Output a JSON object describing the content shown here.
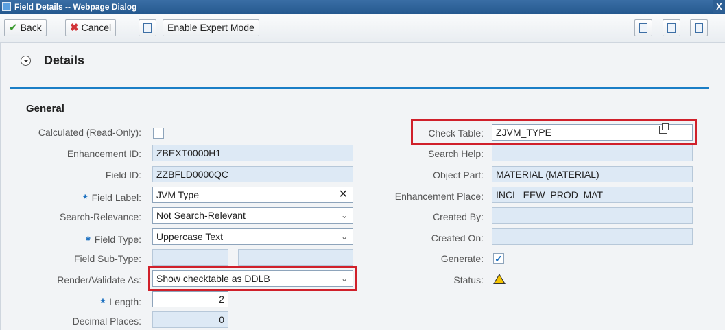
{
  "window": {
    "title": "Field Details -- Webpage Dialog",
    "close_glyph": "X"
  },
  "toolbar": {
    "back_label": "Back",
    "cancel_label": "Cancel",
    "expert_mode_label": "Enable Expert Mode",
    "right_icons": [
      "personalize-icon",
      "list-icon",
      "user-settings-icon"
    ]
  },
  "section": {
    "title": "Details",
    "group_title": "General"
  },
  "left_fields": {
    "calculated": {
      "label": "Calculated (Read-Only):",
      "checked": false
    },
    "enhancement_id": {
      "label": "Enhancement ID:",
      "value": "ZBEXT0000H1"
    },
    "field_id": {
      "label": "Field ID:",
      "value": "ZZBFLD0000QC"
    },
    "field_label": {
      "label": "Field Label:",
      "value": "JVM Type",
      "required": true
    },
    "search_relevance": {
      "label": "Search-Relevance:",
      "value": "Not Search-Relevant"
    },
    "field_type": {
      "label": "Field Type:",
      "value": "Uppercase Text",
      "required": true
    },
    "field_sub_type": {
      "label": "Field Sub-Type:",
      "value": ""
    },
    "render_validate": {
      "label": "Render/Validate As:",
      "value": "Show checktable as DDLB"
    },
    "length": {
      "label": "Length:",
      "value": "2",
      "required": true
    },
    "decimal_places": {
      "label": "Decimal Places:",
      "value": "0"
    }
  },
  "right_fields": {
    "check_table": {
      "label": "Check Table:",
      "value": "ZJVM_TYPE"
    },
    "search_help": {
      "label": "Search Help:",
      "value": ""
    },
    "object_part": {
      "label": "Object Part:",
      "value": "MATERIAL (MATERIAL)"
    },
    "enhancement_place": {
      "label": "Enhancement Place:",
      "value": "INCL_EEW_PROD_MAT"
    },
    "created_by": {
      "label": "Created By:",
      "value": ""
    },
    "created_on": {
      "label": "Created On:",
      "value": ""
    },
    "generate": {
      "label": "Generate:",
      "checked": true
    },
    "status": {
      "label": "Status:",
      "icon": "warning-icon"
    }
  },
  "required_marker": "*",
  "colors": {
    "accent": "#1a7ec6",
    "highlight": "#d0202a",
    "readonly_bg": "#dde9f5"
  }
}
